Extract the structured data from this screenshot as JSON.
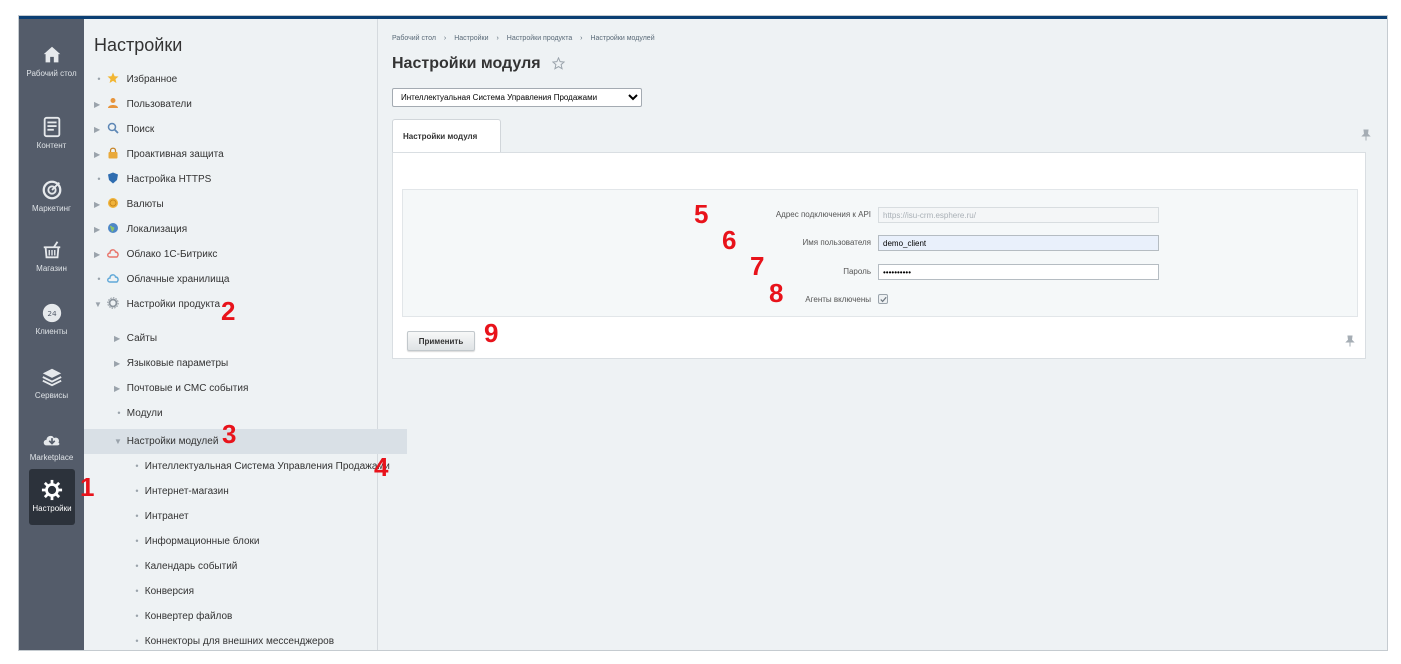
{
  "rail": {
    "items": [
      {
        "label": "Рабочий стол",
        "icon": "home-icon"
      },
      {
        "label": "Контент",
        "icon": "document-icon"
      },
      {
        "label": "Маркетинг",
        "icon": "target-icon"
      },
      {
        "label": "Магазин",
        "icon": "cart-icon"
      },
      {
        "label": "Клиенты",
        "icon": "clients-icon"
      },
      {
        "label": "Сервисы",
        "icon": "layers-icon"
      },
      {
        "label": "Marketplace",
        "icon": "cloud-download-icon"
      },
      {
        "label": "Настройки",
        "icon": "gear-icon",
        "active": true
      }
    ]
  },
  "tree": {
    "title": "Настройки",
    "items": [
      {
        "label": "Избранное",
        "icon": "star-icon"
      },
      {
        "label": "Пользователи",
        "icon": "user-icon"
      },
      {
        "label": "Поиск",
        "icon": "search-icon"
      },
      {
        "label": "Проактивная защита",
        "icon": "lock-icon"
      },
      {
        "label": "Настройка HTTPS",
        "icon": "shield-icon"
      },
      {
        "label": "Валюты",
        "icon": "coin-icon"
      },
      {
        "label": "Локализация",
        "icon": "globe-icon"
      },
      {
        "label": "Облако 1С-Битрикс",
        "icon": "cloud-icon"
      },
      {
        "label": "Облачные хранилища",
        "icon": "storage-icon"
      },
      {
        "label": "Настройки продукта",
        "icon": "settings-icon"
      },
      {
        "label": "Сайты"
      },
      {
        "label": "Языковые параметры"
      },
      {
        "label": "Почтовые и СМС события"
      },
      {
        "label": "Модули"
      },
      {
        "label": "Настройки модулей"
      },
      {
        "label": "Интеллектуальная Система Управления Продажами"
      },
      {
        "label": "Интернет-магазин"
      },
      {
        "label": "Интранет"
      },
      {
        "label": "Информационные блоки"
      },
      {
        "label": "Календарь событий"
      },
      {
        "label": "Конверсия"
      },
      {
        "label": "Конвертер файлов"
      },
      {
        "label": "Коннекторы для внешних мессенджеров"
      }
    ]
  },
  "breadcrumb": [
    "Рабочий стол",
    "›",
    "Настройки",
    "›",
    "Настройки продукта",
    "›",
    "Настройки модулей"
  ],
  "main": {
    "title": "Настройки модуля",
    "module_select": "Интеллектуальная Система Управления Продажами",
    "tab_label": "Настройки модуля",
    "form": {
      "api_label": "Адрес подключения к API",
      "api_value": "https://isu-crm.esphere.ru/",
      "user_label": "Имя пользователя",
      "user_value": "demo_client",
      "pass_label": "Пароль",
      "pass_value": "••••••••••",
      "agents_label": "Агенты включены",
      "agents_checked": true
    },
    "apply_label": "Применить"
  },
  "annotations": [
    "1",
    "2",
    "3",
    "4",
    "5",
    "6",
    "7",
    "8",
    "9"
  ],
  "colors": {
    "rail_bg": "#545c6a",
    "rail_active": "#2c323b",
    "annotation": "#e8131b",
    "topbar": "#0b3f73"
  }
}
